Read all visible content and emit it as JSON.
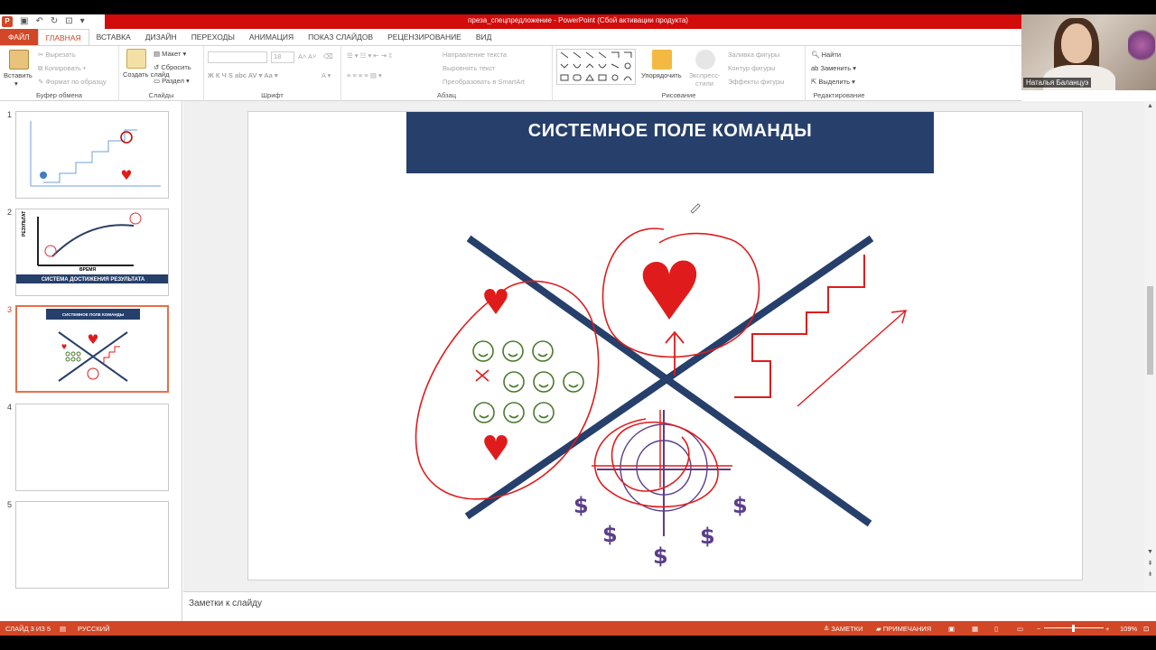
{
  "window": {
    "title": "преза_спецпредложение - PowerPoint (Сбой активации продукта)"
  },
  "tabs": [
    "ФАЙЛ",
    "ГЛАВНАЯ",
    "ВСТАВКА",
    "ДИЗАЙН",
    "ПЕРЕХОДЫ",
    "АНИМАЦИЯ",
    "ПОКАЗ СЛАЙДОВ",
    "РЕЦЕНЗИРОВАНИЕ",
    "ВИД"
  ],
  "ribbon": {
    "clipboard": {
      "label": "Буфер обмена",
      "paste": "Вставить",
      "cut": "Вырезать",
      "copy": "Копировать",
      "format": "Формат по образцу"
    },
    "slides": {
      "label": "Слайды",
      "new_slide": "Создать слайд",
      "layout": "Макет",
      "reset": "Сбросить",
      "section": "Раздел"
    },
    "font": {
      "label": "Шрифт",
      "size": "18"
    },
    "paragraph": {
      "label": "Абзац",
      "text_dir": "Направление текста",
      "align_text": "Выровнять текст",
      "smartart": "Преобразовать в SmartArt"
    },
    "drawing": {
      "label": "Рисование",
      "arrange": "Упорядочить",
      "quick_styles": "Экспресс-стили",
      "fill": "Заливка фигуры",
      "outline": "Контур фигуры",
      "effects": "Эффекты фигуры"
    },
    "editing": {
      "label": "Редактирование",
      "find": "Найти",
      "replace": "Заменить",
      "select": "Выделить"
    }
  },
  "webcam": {
    "name": "Наталья Баланцуэ"
  },
  "thumbnails": [
    {
      "num": "1"
    },
    {
      "num": "2",
      "ylabel": "РЕЗУЛЬТАТ",
      "xlabel": "ВРЕМЯ",
      "banner": "СИСТЕМА ДОСТИЖЕНИЯ РЕЗУЛЬТАТА"
    },
    {
      "num": "3",
      "banner": "СИСТЕМНОЕ ПОЛЕ КОМАНДЫ"
    },
    {
      "num": "4"
    },
    {
      "num": "5"
    }
  ],
  "slide": {
    "title": "СИСТЕМНОЕ ПОЛЕ КОМАНДЫ",
    "dollar": "$"
  },
  "notes": {
    "placeholder": "Заметки к слайду"
  },
  "status": {
    "slide_info": "СЛАЙД 3 ИЗ 5",
    "language": "РУССКИЙ",
    "notes_btn": "ЗАМЕТКИ",
    "comments_btn": "ПРИМЕЧАНИЯ",
    "zoom": "109%"
  },
  "colors": {
    "accent": "#d24726",
    "title_bar": "#d20b0b",
    "slide_banner": "#263f6b",
    "sketch_red": "#e01b1b"
  }
}
